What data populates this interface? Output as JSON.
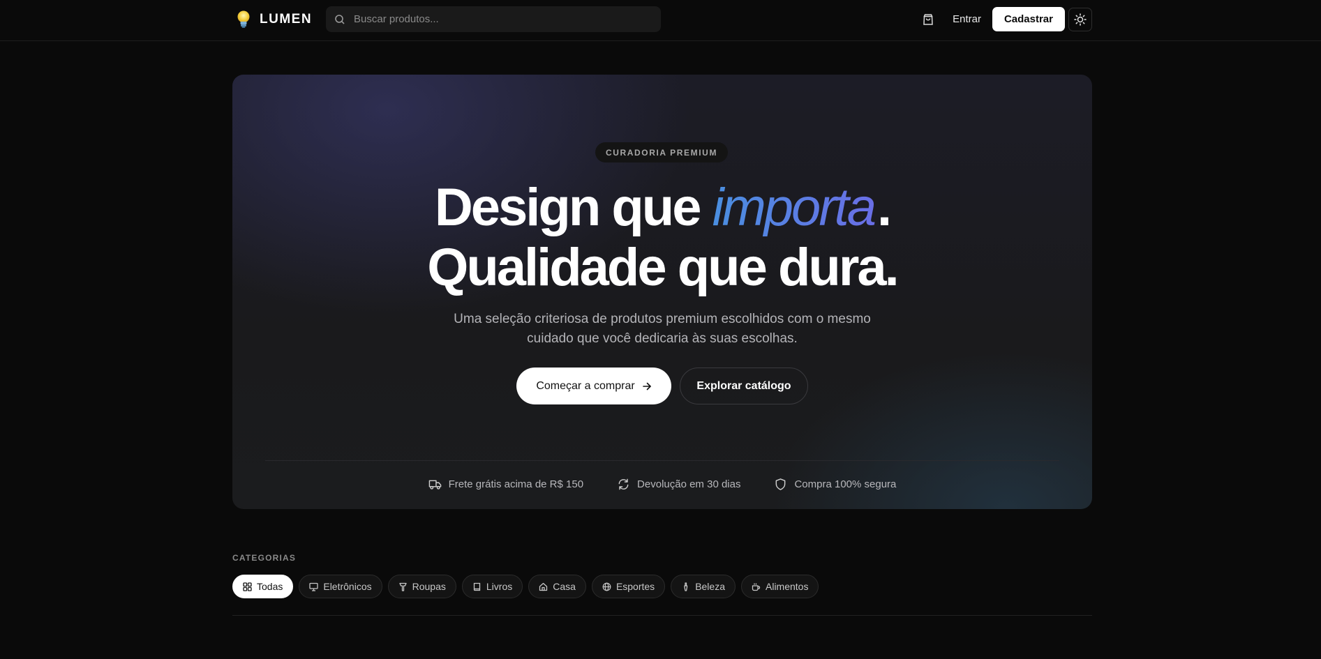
{
  "header": {
    "brand": "LUMEN",
    "search_placeholder": "Buscar produtos...",
    "login_label": "Entrar",
    "signup_label": "Cadastrar",
    "icons": [
      "bulb-icon",
      "search-icon",
      "shopping-bag-icon",
      "sun-icon"
    ]
  },
  "hero": {
    "badge": "CURADORIA PREMIUM",
    "headline_line1_start": "Design que ",
    "headline_line1_accent": "importa",
    "headline_line1_end": ".",
    "headline_line2": "Qualidade que dura.",
    "subtitle": "Uma seleção criteriosa de produtos premium escolhidos com o mesmo cuidado que você dedicaria às suas escolhas.",
    "cta_primary": "Começar a comprar",
    "cta_secondary": "Explorar catálogo",
    "accent_colors": [
      "#4a8fe0",
      "#6a6ee6"
    ],
    "features": [
      {
        "icon": "truck-icon",
        "label": "Frete grátis acima de R$ 150"
      },
      {
        "icon": "refresh-icon",
        "label": "Devolução em 30 dias"
      },
      {
        "icon": "shield-icon",
        "label": "Compra 100% segura"
      }
    ]
  },
  "categories": {
    "title": "CATEGORIAS",
    "selected": "Todas",
    "items": [
      {
        "icon": "grid-icon",
        "label": "Todas"
      },
      {
        "icon": "monitor-icon",
        "label": "Eletrônicos"
      },
      {
        "icon": "shirt-icon",
        "label": "Roupas"
      },
      {
        "icon": "book-icon",
        "label": "Livros"
      },
      {
        "icon": "home-icon",
        "label": "Casa"
      },
      {
        "icon": "globe-icon",
        "label": "Esportes"
      },
      {
        "icon": "brush-icon",
        "label": "Beleza"
      },
      {
        "icon": "coffee-icon",
        "label": "Alimentos"
      }
    ]
  }
}
